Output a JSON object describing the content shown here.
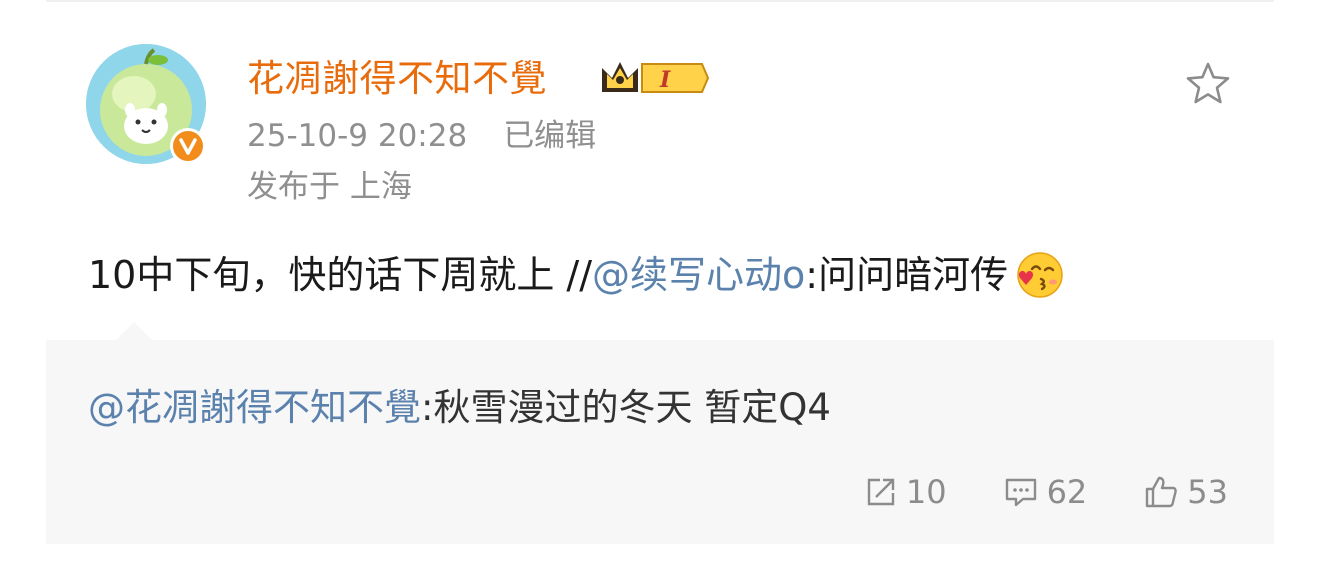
{
  "post": {
    "username": "花凋謝得不知不覺",
    "vip_level": "I",
    "timestamp": "25-10-9 20:28",
    "edited_label": "已编辑",
    "location": "发布于 上海",
    "text_prefix": "10中下旬，快的话下周就上 //",
    "mention": "@续写心动o",
    "text_suffix": ":问问暗河传",
    "emoji": "kissing-face-emoji"
  },
  "repost": {
    "mention": "@花凋謝得不知不覺",
    "text": ":秋雪漫过的冬天 暂定Q4"
  },
  "actions": {
    "share_count": "10",
    "comment_count": "62",
    "like_count": "53"
  },
  "colors": {
    "username": "#e86b0c",
    "mention": "#5b82ad",
    "meta": "#8f8f8f",
    "repost_bg": "#f7f7f7",
    "verified_badge": "#f28d1b"
  }
}
